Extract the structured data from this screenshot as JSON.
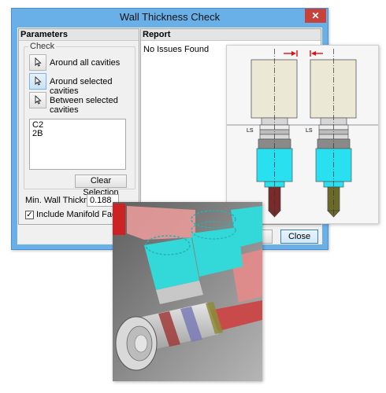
{
  "window": {
    "title": "Wall Thickness Check",
    "close_glyph": "✕"
  },
  "parameters": {
    "header": "Parameters",
    "group_label": "Check",
    "options": [
      {
        "label": "Around all cavities",
        "icon": "cursor-icon"
      },
      {
        "label": "Around selected cavities",
        "icon": "cursor-icon",
        "active": true
      },
      {
        "label": "Between selected cavities",
        "icon": "cursor-icon"
      }
    ],
    "selection_list": [
      "C2",
      "2B"
    ],
    "clear_selection_label": "Clear Selection",
    "min_wall_thickness_label": "Min. Wall Thickness",
    "min_wall_thickness_value": "0.188",
    "include_manifold_faces_label": "Include Manifold Faces",
    "include_manifold_faces_checked": true
  },
  "report": {
    "header": "Report",
    "status_text": "No Issues Found"
  },
  "buttons": {
    "ok_label_partial": "t",
    "close_label": "Close"
  },
  "diagram": {
    "ls_label_left": "LS",
    "ls_label_right": "LS",
    "colors": {
      "cap": "#ece8d6",
      "collar": "#d9d9d9",
      "cavity": "#29e0f0",
      "tip_left": "#7a2a2a",
      "tip_right": "#6b6a2a",
      "arrow": "#dd1111"
    }
  },
  "render_colors": {
    "background": "#8c8c8c",
    "cyan": "#33d8d8",
    "pink": "#e89a9a",
    "red": "#cc2222",
    "gray": "#c8c8c8"
  }
}
